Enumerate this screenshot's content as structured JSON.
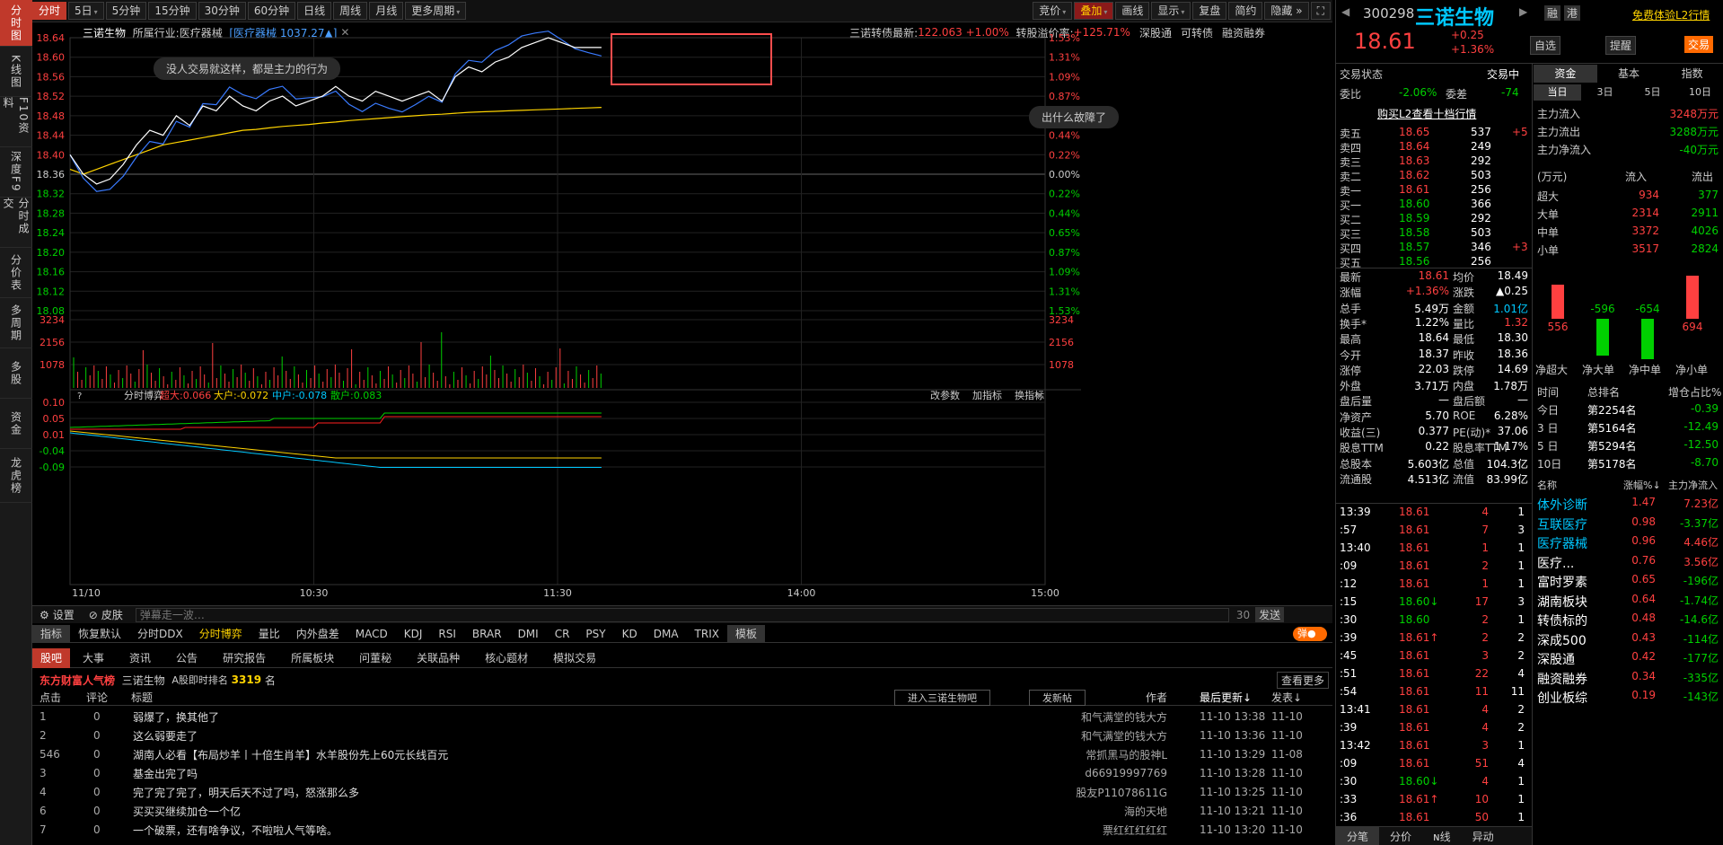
{
  "nav": {
    "items": [
      "分时图",
      "K线图",
      "F10资料",
      "深度F9",
      "分时成交",
      "分价表",
      "多周期",
      "多股",
      "资金",
      "龙虎榜"
    ]
  },
  "toolbar": {
    "periods": [
      "分时",
      "5日",
      "5分钟",
      "15分钟",
      "30分钟",
      "60分钟",
      "日线",
      "周线",
      "月线",
      "更多周期"
    ],
    "right": [
      "竞价",
      "叠加",
      "画线",
      "显示",
      "复盘",
      "简约",
      "隐藏"
    ]
  },
  "chart": {
    "stock": "三诺生物",
    "industry_label": "所属行业:",
    "industry": "医疗器械",
    "overlay": "[医疗器械 1037.27▲]",
    "bond": "三诺转债最新:",
    "bond_price": "122.063",
    "bond_pct": "+1.00%",
    "premium_label": "转股溢价率:",
    "premium": "+125.71%",
    "links": [
      "深股通",
      "可转债",
      "融资融券"
    ],
    "bubble1": "没人交易就这样，都是主力的行为",
    "bubble2": "出什么故障了",
    "prices_left": [
      "18.64",
      "18.60",
      "18.56",
      "18.52",
      "18.48",
      "18.44",
      "18.40",
      "18.36",
      "18.32",
      "18.28",
      "18.24",
      "18.20",
      "18.16",
      "18.12",
      "18.08"
    ],
    "pcts_right": [
      "1.53%",
      "1.31%",
      "1.09%",
      "0.87%",
      "0.65%",
      "0.44%",
      "0.22%",
      "0.00%",
      "0.22%",
      "0.44%",
      "0.65%",
      "0.87%",
      "1.09%",
      "1.31%",
      "1.53%"
    ],
    "vol_labels": [
      "3234",
      "2156",
      "1078"
    ],
    "xaxis": [
      "11/10",
      "10:30",
      "11:30",
      "14:00",
      "15:00"
    ],
    "boyi": {
      "name": "分时博弈",
      "super": "超大:0.066",
      "big": "大户:-0.072",
      "mid": "中户:-0.078",
      "small": "散户:0.083",
      "axis": [
        "0.10",
        "0.05",
        "0.01",
        "-0.04",
        "-0.09"
      ],
      "links": [
        "改参数",
        "加指标",
        "换指标"
      ]
    }
  },
  "chart_data": {
    "type": "line",
    "x_range": [
      "9:30",
      "15:00"
    ],
    "ylim": [
      18.08,
      18.64
    ],
    "base": 18.36,
    "series": [
      {
        "name": "三诺生物",
        "values": [
          18.4,
          18.36,
          18.34,
          18.35,
          18.38,
          18.42,
          18.45,
          18.44,
          18.48,
          18.46,
          18.5,
          18.49,
          18.52,
          18.5,
          18.49,
          18.51,
          18.52,
          18.5,
          18.51,
          18.52,
          18.54,
          18.52,
          18.51,
          18.53,
          18.52,
          18.51,
          18.52,
          18.53,
          18.51,
          18.56,
          18.58,
          18.57,
          18.59,
          18.6,
          18.62,
          18.63,
          18.64,
          18.63,
          18.62,
          18.62,
          18.62
        ]
      },
      {
        "name": "均价",
        "values": [
          18.37,
          18.36,
          18.37,
          18.38,
          18.39,
          18.4,
          18.41,
          18.42,
          18.425,
          18.43,
          18.435,
          18.44,
          18.445,
          18.45,
          18.452,
          18.455,
          18.458,
          18.46,
          18.462,
          18.465,
          18.467,
          18.47,
          18.472,
          18.474,
          18.476,
          18.478,
          18.48,
          18.482,
          18.483,
          18.485,
          18.487,
          18.488,
          18.489,
          18.49,
          18.491,
          18.492,
          18.493,
          18.494,
          18.495,
          18.496,
          18.497
        ]
      }
    ]
  },
  "settings": {
    "set": "设置",
    "skin": "皮肤",
    "danmu": "弹幕走一波…",
    "count": "30",
    "send": "发送"
  },
  "indtabs": [
    "指标",
    "恢复默认",
    "分时DDX",
    "分时博弈",
    "量比",
    "内外盘差",
    "MACD",
    "KDJ",
    "RSI",
    "BRAR",
    "DMI",
    "CR",
    "PSY",
    "KD",
    "DMA",
    "TRIX",
    "模板"
  ],
  "guba": {
    "tabs": [
      "股吧",
      "大事",
      "资讯",
      "公告",
      "研究报告",
      "所属板块",
      "问董秘",
      "关联品种",
      "核心题材",
      "模拟交易"
    ],
    "rank_title": "东方财富人气榜",
    "rank_stock": "三诺生物",
    "rank_label": "A股即时排名",
    "rank": "3319",
    "rank_unit": "名",
    "more": "查看更多",
    "cols": [
      "点击",
      "评论",
      "标题",
      "作者",
      "最后更新↓",
      "发表↓"
    ],
    "btn1": "进入三诺生物吧",
    "btn2": "发新帖",
    "posts": [
      [
        "1",
        "0",
        "弱爆了，换其他了",
        "和气满堂的钱大方",
        "11-10 13:38",
        "11-10"
      ],
      [
        "2",
        "0",
        "这么弱要走了",
        "和气满堂的钱大方",
        "11-10 13:36",
        "11-10"
      ],
      [
        "546",
        "0",
        "湖南人必看【布局炒羊丨十倍生肖羊】水羊股份先上60元长线百元",
        "常抓黑马的股神L",
        "11-10 13:29",
        "11-08"
      ],
      [
        "3",
        "0",
        "基金出完了吗",
        "d66919997769",
        "11-10 13:28",
        "11-10"
      ],
      [
        "4",
        "0",
        "完了完了完了，明天后天不过了吗，怒涨那么多",
        "股友P11078611G",
        "11-10 13:25",
        "11-10"
      ],
      [
        "6",
        "0",
        "买买买继续加仓一个亿",
        "海的天地",
        "11-10 13:21",
        "11-10"
      ],
      [
        "7",
        "0",
        "一个破票，还有啥争议，不啦啦人气等啥。",
        "票红红红红红",
        "11-10 13:20",
        "11-10"
      ]
    ]
  },
  "quote": {
    "code": "300298",
    "name": "三诺生物",
    "price": "18.61",
    "chg": "+0.25",
    "pct": "+1.36%",
    "free": "免费体验L2行情",
    "zixuan": "自选",
    "tixing": "提醒",
    "jiaoyi": "交易",
    "rong": "融",
    "gang": "港",
    "status_label": "交易状态",
    "status": "交易中",
    "weibi_l": "委比",
    "weibi": "-2.06%",
    "weicha_l": "委差",
    "weicha": "-74",
    "l2": "购买L2查看十档行情",
    "asks": [
      [
        "卖五",
        "18.65",
        "537",
        "+5"
      ],
      [
        "卖四",
        "18.64",
        "249",
        ""
      ],
      [
        "卖三",
        "18.63",
        "292",
        ""
      ],
      [
        "卖二",
        "18.62",
        "503",
        ""
      ],
      [
        "卖一",
        "18.61",
        "256",
        ""
      ]
    ],
    "bids": [
      [
        "买一",
        "18.60",
        "366",
        ""
      ],
      [
        "买二",
        "18.59",
        "292",
        ""
      ],
      [
        "买三",
        "18.58",
        "503",
        ""
      ],
      [
        "买四",
        "18.57",
        "346",
        "+3"
      ],
      [
        "买五",
        "18.56",
        "256",
        ""
      ]
    ],
    "stats": [
      [
        "最新",
        "18.61",
        "均价",
        "18.49"
      ],
      [
        "涨幅",
        "+1.36%",
        "涨跌",
        "▲0.25"
      ],
      [
        "总手",
        "5.49万",
        "金额",
        "1.01亿"
      ],
      [
        "换手*",
        "1.22%",
        "量比",
        "1.32"
      ],
      [
        "最高",
        "18.64",
        "最低",
        "18.30"
      ],
      [
        "今开",
        "18.37",
        "昨收",
        "18.36"
      ],
      [
        "涨停",
        "22.03",
        "跌停",
        "14.69"
      ],
      [
        "外盘",
        "3.71万",
        "内盘",
        "1.78万"
      ],
      [
        "盘后量",
        "—",
        "盘后额",
        "—"
      ],
      [
        "净资产",
        "5.70",
        "ROE",
        "6.28%"
      ],
      [
        "收益(三)",
        "0.377",
        "PE(动)*",
        "37.06"
      ],
      [
        "股息TTM",
        "0.22",
        "股息率TTM",
        "1.17%"
      ],
      [
        "总股本",
        "5.603亿",
        "总值",
        "104.3亿"
      ],
      [
        "流通股",
        "4.513亿",
        "流值",
        "83.99亿"
      ]
    ],
    "ticks": [
      [
        "13:39",
        "18.61",
        "4",
        "1"
      ],
      [
        ":57",
        "18.61",
        "7",
        "3"
      ],
      [
        "13:40",
        "18.61",
        "1",
        "1"
      ],
      [
        ":09",
        "18.61",
        "2",
        "1"
      ],
      [
        ":12",
        "18.61",
        "1",
        "1"
      ],
      [
        ":15",
        "18.60↓",
        "17",
        "3"
      ],
      [
        ":30",
        "18.60",
        "2",
        "1"
      ],
      [
        ":39",
        "18.61↑",
        "2",
        "2"
      ],
      [
        ":45",
        "18.61",
        "3",
        "2"
      ],
      [
        ":51",
        "18.61",
        "22",
        "4"
      ],
      [
        ":54",
        "18.61",
        "11",
        "11"
      ],
      [
        "13:41",
        "18.61",
        "4",
        "2"
      ],
      [
        ":39",
        "18.61",
        "4",
        "2"
      ],
      [
        "13:42",
        "18.61",
        "3",
        "1"
      ],
      [
        ":09",
        "18.61",
        "51",
        "4"
      ],
      [
        ":30",
        "18.60↓",
        "4",
        "1"
      ],
      [
        ":33",
        "18.61↑",
        "10",
        "1"
      ],
      [
        ":36",
        "18.61",
        "50",
        "1"
      ]
    ],
    "bottomtabs": [
      "分笔",
      "分价",
      "ɴ线",
      "异动"
    ]
  },
  "fund": {
    "tabs": [
      "资金",
      "基本",
      "指数"
    ],
    "periods": [
      "当日",
      "3日",
      "5日",
      "10日"
    ],
    "main": [
      [
        "主力流入",
        "3248万元"
      ],
      [
        "主力流出",
        "3288万元"
      ],
      [
        "主力净流入",
        "-40万元"
      ]
    ],
    "unit": "(万元)",
    "in": "流入",
    "out": "流出",
    "rows": [
      [
        "超大",
        "934",
        "377"
      ],
      [
        "大单",
        "2314",
        "2911"
      ],
      [
        "中单",
        "3372",
        "4026"
      ],
      [
        "小单",
        "3517",
        "2824"
      ]
    ],
    "bars": [
      [
        "556",
        "净超大"
      ],
      [
        "-596",
        "净大单"
      ],
      [
        "-654",
        "净中单"
      ],
      [
        "694",
        "净小单"
      ]
    ],
    "rank_cols": [
      "时间",
      "总排名",
      "增仓占比%"
    ],
    "ranks": [
      [
        "今日",
        "第2254名",
        "-0.39"
      ],
      [
        "3 日",
        "第5164名",
        "-12.49"
      ],
      [
        "5 日",
        "第5294名",
        "-12.50"
      ],
      [
        "10日",
        "第5178名",
        "-8.70"
      ]
    ],
    "sector_cols": [
      "名称",
      "涨幅%↓",
      "主力净流入"
    ],
    "sectors": [
      [
        "体外诊断",
        "1.47",
        "7.23亿"
      ],
      [
        "互联医疗",
        "0.98",
        "-3.37亿"
      ],
      [
        "医疗器械",
        "0.96",
        "4.46亿"
      ],
      [
        "医疗...",
        "0.76",
        "3.56亿"
      ],
      [
        "富时罗素",
        "0.65",
        "-196亿"
      ],
      [
        "湖南板块",
        "0.64",
        "-1.74亿"
      ],
      [
        "转债标的",
        "0.48",
        "-14.6亿"
      ],
      [
        "深成500",
        "0.43",
        "-114亿"
      ],
      [
        "深股通",
        "0.42",
        "-177亿"
      ],
      [
        "融资融券",
        "0.34",
        "-335亿"
      ],
      [
        "创业板综",
        "0.19",
        "-143亿"
      ]
    ]
  }
}
